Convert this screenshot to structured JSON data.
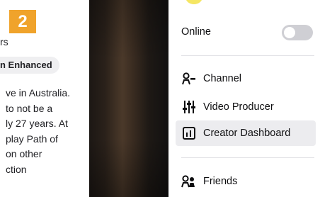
{
  "step_badge": "2",
  "left_text": {
    "fragment_top": "rs",
    "tag": "n Enhanced",
    "lines": [
      "ve in Australia.",
      " to not be a",
      "ly 27 years. At",
      "play Path of",
      " on other",
      "ction"
    ]
  },
  "menu": {
    "online": {
      "label": "Online",
      "toggle_on": false
    },
    "items": [
      {
        "label": "Channel",
        "icon": "channel-person-icon"
      },
      {
        "label": "Video Producer",
        "icon": "sliders-icon"
      },
      {
        "label": "Creator Dashboard",
        "icon": "bar-chart-icon"
      },
      {
        "label": "Friends",
        "icon": "friends-icon"
      }
    ]
  },
  "colors": {
    "badge": "#f0a32b",
    "hover_row": "#ececef",
    "toggle_off": "#cfcfd4"
  }
}
